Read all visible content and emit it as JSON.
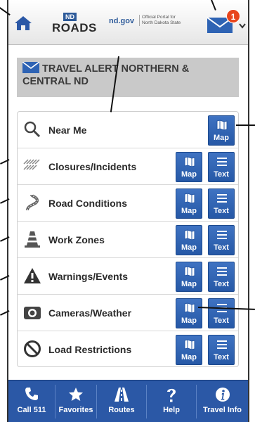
{
  "header": {
    "logo_nd": "ND",
    "logo_roads": "ROADS",
    "logo_ndgov": "nd.gov",
    "logo_portal": "Official Portal for North Dakota State",
    "mail_badge": "1"
  },
  "alert": {
    "text": "TRAVEL ALERT NORTHERN & CENTRAL ND"
  },
  "menu": {
    "map_label": "Map",
    "text_label": "Text",
    "items": [
      {
        "label": "Near Me",
        "icon": "magnifier-icon"
      },
      {
        "label": "Closures/Incidents",
        "icon": "closure-icon"
      },
      {
        "label": "Road Conditions",
        "icon": "road-icon"
      },
      {
        "label": "Work Zones",
        "icon": "cone-icon"
      },
      {
        "label": "Warnings/Events",
        "icon": "warning-icon"
      },
      {
        "label": "Cameras/Weather",
        "icon": "camera-icon"
      },
      {
        "label": "Load Restrictions",
        "icon": "restriction-icon"
      }
    ]
  },
  "footer": {
    "items": [
      {
        "label": "Call 511",
        "icon": "phone-icon"
      },
      {
        "label": "Favorites",
        "icon": "star-icon"
      },
      {
        "label": "Routes",
        "icon": "road-routes-icon"
      },
      {
        "label": "Help",
        "icon": "question-icon"
      },
      {
        "label": "Travel Info",
        "icon": "info-icon"
      }
    ]
  },
  "colors": {
    "brand_blue": "#2b58a6",
    "button_blue": "#2f63b3",
    "alert_gray": "#c9c9c9",
    "badge_orange": "#e8451c"
  }
}
